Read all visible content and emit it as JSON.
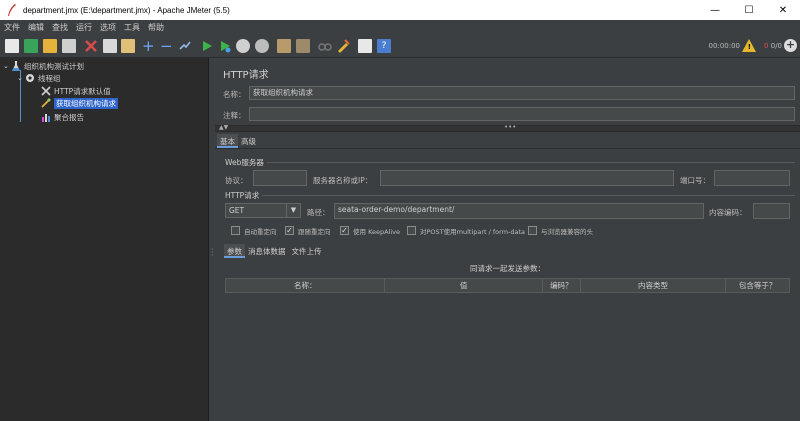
{
  "window": {
    "title": "department.jmx (E:\\department.jmx) - Apache JMeter (5.5)",
    "minimize": "—",
    "maximize": "☐",
    "close": "✕"
  },
  "menu": [
    "文件",
    "编辑",
    "查找",
    "运行",
    "选项",
    "工具",
    "帮助"
  ],
  "toolbar": {
    "timer": "00:00:00",
    "warnings": "0",
    "threads": "0/0"
  },
  "tree": {
    "plan": "组织机构测试计划",
    "thread_group": "线程组",
    "http_defaults": "HTTP请求默认值",
    "selected_request": "获取组织机构请求",
    "aggregate": "聚合报告"
  },
  "panel": {
    "title": "HTTP请求",
    "name_label": "名称：",
    "name_value": "获取组织机构请求",
    "comment_label": "注释：",
    "comment_value": "",
    "tabs": [
      "基本",
      "高级"
    ],
    "web_server": {
      "title": "Web服务器",
      "protocol_label": "协议：",
      "protocol_value": "",
      "server_label": "服务器名称或IP：",
      "server_value": "",
      "port_label": "端口号：",
      "port_value": ""
    },
    "http_request": {
      "title": "HTTP请求",
      "method": "GET",
      "path_label": "路径：",
      "path_value": "seata-order-demo/department/",
      "encoding_label": "内容编码：",
      "encoding_value": ""
    },
    "options": [
      {
        "label": "自动重定向",
        "checked": false
      },
      {
        "label": "跟随重定向",
        "checked": true
      },
      {
        "label": "使用 KeepAlive",
        "checked": true
      },
      {
        "label": "对POST使用multipart / form-data",
        "checked": false
      },
      {
        "label": "与浏览器兼容的头",
        "checked": false
      }
    ],
    "sub_tabs": [
      "参数",
      "消息体数据",
      "文件上传"
    ],
    "params_caption": "同请求一起发送参数：",
    "columns": [
      "名称：",
      "值",
      "编码？",
      "内容类型",
      "包含等于？"
    ]
  },
  "colors": {
    "background": "#3c3f41",
    "tree_bg": "#2b2b2b",
    "selection": "#2f65ca",
    "accent_warn": "#e5b82a"
  }
}
